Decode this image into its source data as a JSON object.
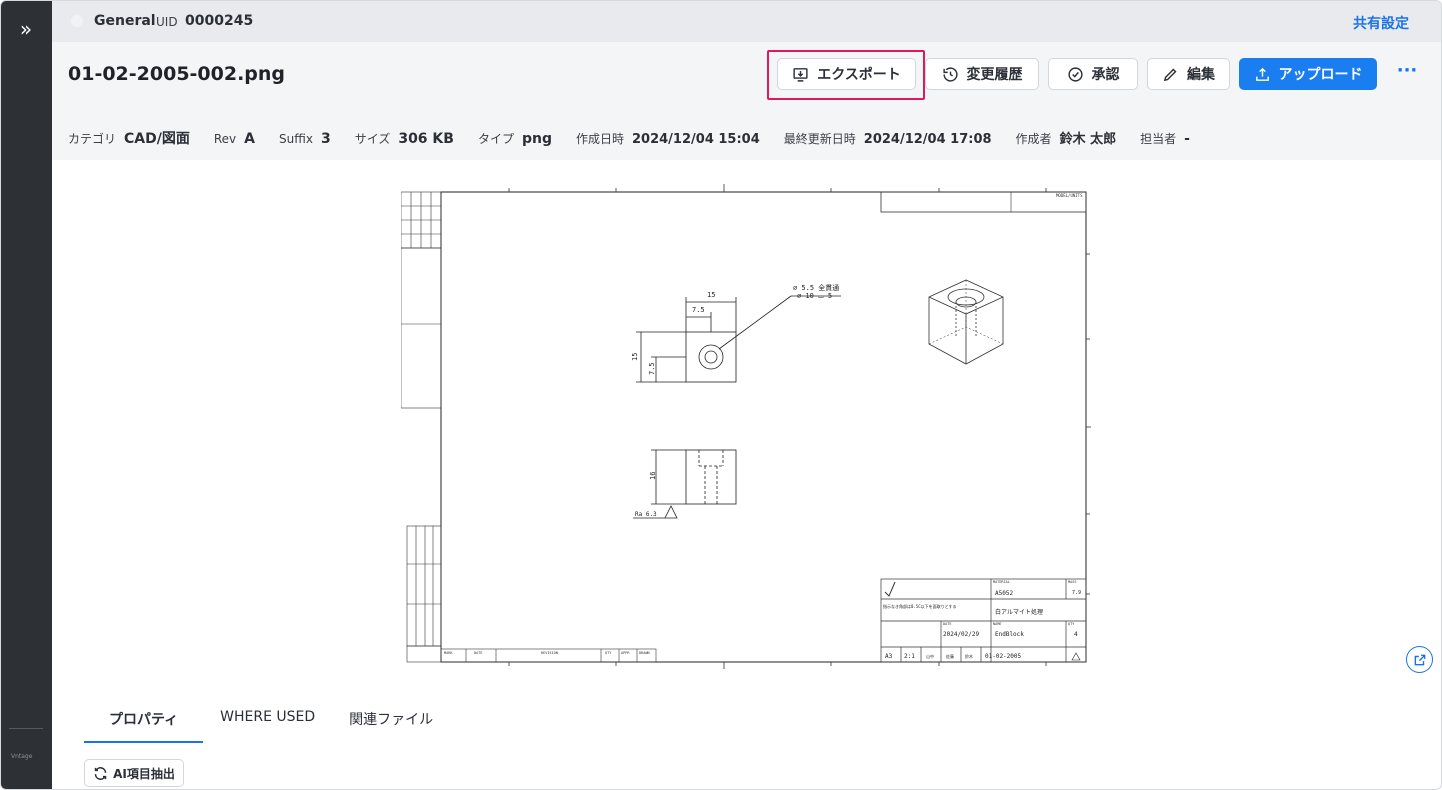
{
  "sidebar": {
    "expand_icon": "double-chevron-right-icon",
    "footer_text": "Vntage"
  },
  "topbar": {
    "workspace": "General",
    "uid_label": "UID",
    "uid": "0000245",
    "share_label": "共有設定"
  },
  "file": {
    "title": "01-02-2005-002.png"
  },
  "toolbar": {
    "export_label": "エクスポート",
    "history_label": "変更履歴",
    "approve_label": "承認",
    "edit_label": "編集",
    "upload_label": "アップロード",
    "more_label": "···",
    "accent_color": "#1a7df0",
    "highlight_color": "#e0195c"
  },
  "meta": [
    {
      "key": "カテゴリ",
      "value": "CAD/図面"
    },
    {
      "key": "Rev",
      "value": "A"
    },
    {
      "key": "Suffix",
      "value": "3"
    },
    {
      "key": "サイズ",
      "value": "306 KB"
    },
    {
      "key": "タイプ",
      "value": "png"
    },
    {
      "key": "作成日時",
      "value": "2024/12/04 15:04"
    },
    {
      "key": "最終更新日時",
      "value": "2024/12/04 17:08"
    },
    {
      "key": "作成者",
      "value": "鈴木 太郎"
    },
    {
      "key": "担当者",
      "value": "-"
    }
  ],
  "drawing": {
    "dim_15_top": "15",
    "dim_7_5_top": "7.5",
    "dim_15_left": "15",
    "dim_7_5_left": "7.5",
    "hole_callout_1": "⌀ 5.5 全貫通",
    "hole_callout_2": "⌀ 10 ⌴ 5",
    "dim_16": "16",
    "roughness": "Ra 6.3",
    "header_tag": "MODEL/UNITS",
    "material_label": "MATERIAL",
    "material": "A5052",
    "mass_label": "MASS",
    "mass": "7.9",
    "finish_note": "指示なき角部は0.5C以下を面取りとする",
    "finish": "白アルマイト処理",
    "date_label": "DATE",
    "date": "2024/02/29",
    "name_label": "NAME",
    "name": "EndBlock",
    "qty_label": "QTY",
    "qty": "4",
    "sheet": "A3",
    "scale": "2:1",
    "drawn": "山中",
    "check": "佐藤",
    "approve": "鈴木",
    "dwg_no": "01-02-2005",
    "revision_header": "REVISION",
    "mark_header": "MARK",
    "date_header": "DATE",
    "qty_header": "QTY",
    "appr_header": "APPR",
    "drawn_header": "DRAWN"
  },
  "tabs": [
    {
      "label": "プロパティ",
      "active": true
    },
    {
      "label": "WHERE USED",
      "active": false
    },
    {
      "label": "関連ファイル",
      "active": false
    }
  ],
  "ai_button_label": "AI項目抽出"
}
